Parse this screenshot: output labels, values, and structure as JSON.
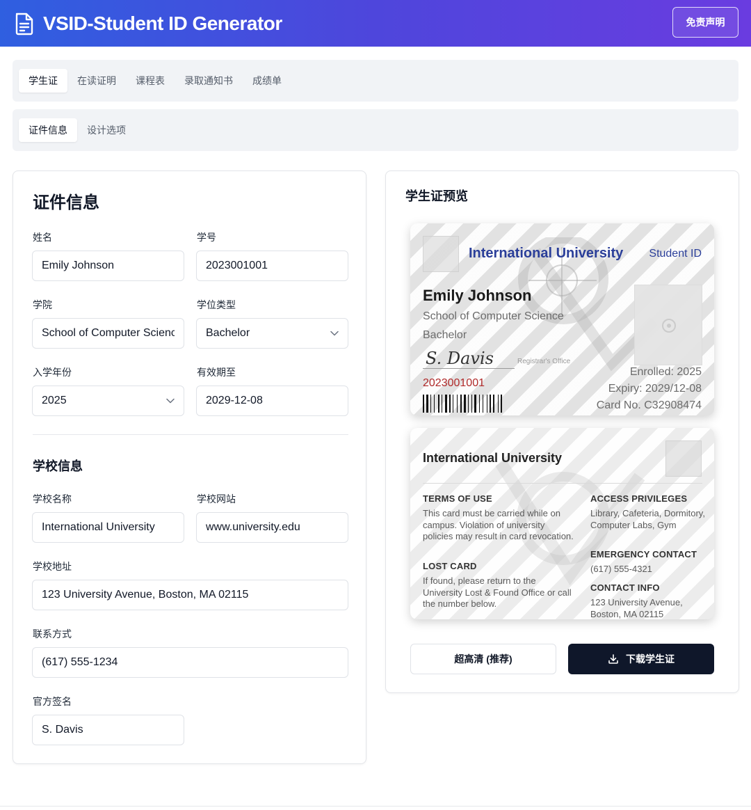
{
  "header": {
    "title": "VSID-Student ID Generator",
    "disclaimer_label": "免责声明"
  },
  "main_tabs": [
    {
      "label": "学生证",
      "active": true
    },
    {
      "label": "在读证明",
      "active": false
    },
    {
      "label": "课程表",
      "active": false
    },
    {
      "label": "录取通知书",
      "active": false
    },
    {
      "label": "成绩单",
      "active": false
    }
  ],
  "sub_tabs": [
    {
      "label": "证件信息",
      "active": true
    },
    {
      "label": "设计选项",
      "active": false
    }
  ],
  "form": {
    "title": "证件信息",
    "name_label": "姓名",
    "name_value": "Emily Johnson",
    "student_no_label": "学号",
    "student_no_value": "2023001001",
    "college_label": "学院",
    "college_value": "School of Computer Science",
    "degree_label": "学位类型",
    "degree_value": "Bachelor",
    "year_label": "入学年份",
    "year_value": "2025",
    "expiry_label": "有效期至",
    "expiry_value": "2029-12-08",
    "school_section_title": "学校信息",
    "school_name_label": "学校名称",
    "school_name_value": "International University",
    "school_site_label": "学校网站",
    "school_site_value": "www.university.edu",
    "address_label": "学校地址",
    "address_value": "123 University Avenue, Boston, MA 02115",
    "contact_label": "联系方式",
    "contact_value": "(617) 555-1234",
    "signature_label": "官方签名",
    "signature_value": "S. Davis"
  },
  "preview": {
    "title": "学生证预览",
    "front": {
      "university": "International University",
      "card_type": "Student ID",
      "student_name": "Emily Johnson",
      "college": "School of Computer Science",
      "degree": "Bachelor",
      "signature": "S. Davis",
      "registrar": "Registrar's Office",
      "student_number": "2023001001",
      "enrolled": "Enrolled: 2025",
      "expiry": "Expiry: 2029/12-08",
      "card_no": "Card No. C32908474"
    },
    "back": {
      "university": "International University",
      "terms_heading": "TERMS OF USE",
      "terms_text": "This card must be carried while on campus. Violation of university policies may result in card revocation.",
      "lost_heading": "LOST CARD",
      "lost_text": "If found, please return to the University Lost & Found Office or call the number below.",
      "access_heading": "ACCESS PRIVILEGES",
      "access_text": "Library, Cafeteria, Dormitory, Computer Labs, Gym",
      "emergency_heading": "EMERGENCY CONTACT",
      "emergency_text": "(617) 555-4321",
      "contact_heading": "CONTACT INFO",
      "contact_text": "123 University Avenue, Boston, MA 02115"
    },
    "hd_button_label": "超高清 (推荐)",
    "download_button_label": "下载学生证"
  },
  "colors": {
    "header_gradient_start": "#2f5fe0",
    "header_gradient_end": "#6a3ce0",
    "card_accent": "#2a3e99",
    "student_number_red": "#b02a2a",
    "primary_button": "#0f172a"
  },
  "icons": {
    "header": "document-icon",
    "download": "download-icon",
    "select": "chevron-down-icon"
  }
}
